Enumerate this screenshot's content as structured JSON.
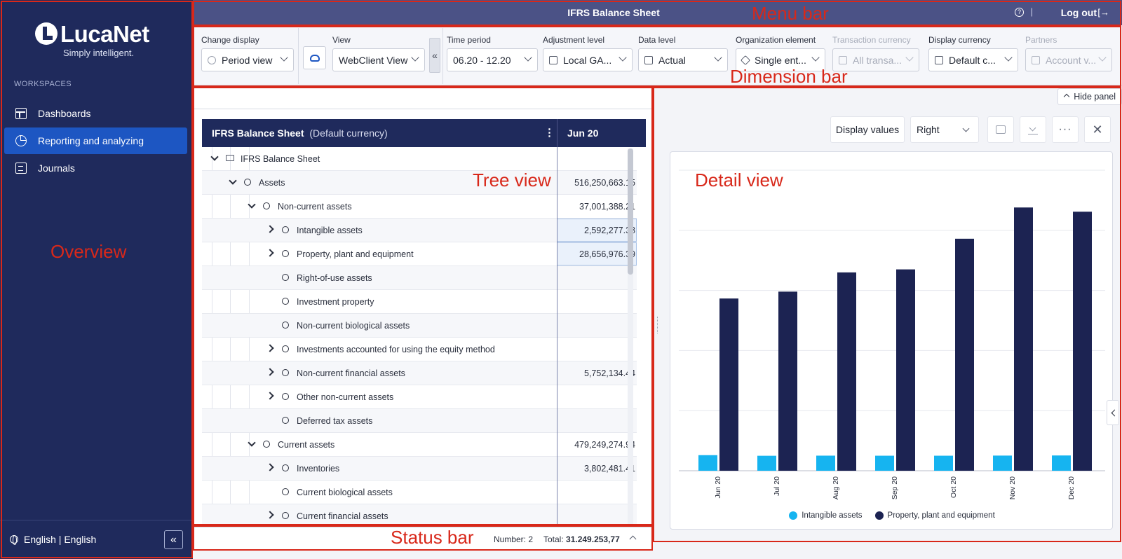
{
  "app": {
    "logo_name": "LucaNet",
    "logo_tagline": "Simply intelligent."
  },
  "sidebar": {
    "workspaces_label": "WORKSPACES",
    "items": [
      {
        "label": "Dashboards",
        "icon": "dashboard-icon",
        "active": false
      },
      {
        "label": "Reporting and analyzing",
        "icon": "pie-chart-icon",
        "active": true
      },
      {
        "label": "Journals",
        "icon": "journal-icon",
        "active": false
      }
    ],
    "language": "English | English",
    "collapse_label": "«"
  },
  "menubar": {
    "title": "IFRS Balance Sheet",
    "help_label": "?",
    "separator": "|",
    "logout_label": "Log out",
    "logout_icon": "[→"
  },
  "dimensions": {
    "change_display": {
      "label": "Change display",
      "value": "Period view"
    },
    "view": {
      "label": "View",
      "value": "WebClient View"
    },
    "collapse_label": "«",
    "time_period": {
      "label": "Time period",
      "value": "06.20 - 12.20"
    },
    "adjustment_level": {
      "label": "Adjustment level",
      "value": "Local GA..."
    },
    "data_level": {
      "label": "Data level",
      "value": "Actual"
    },
    "organization_element": {
      "label": "Organization element",
      "value": "Single ent..."
    },
    "transaction_currency": {
      "label": "Transaction currency",
      "value": "All transa..."
    },
    "display_currency": {
      "label": "Display currency",
      "value": "Default c..."
    },
    "partners": {
      "label": "Partners",
      "value": "Account v..."
    }
  },
  "tree": {
    "title": "IFRS Balance Sheet",
    "subtitle": "(Default currency)",
    "menu_icon": "⋮",
    "column": "Jun 20",
    "rows": [
      {
        "label": "IFRS Balance Sheet",
        "value": "",
        "level": 0,
        "expand": "down",
        "type": "folder",
        "selected": false
      },
      {
        "label": "Assets",
        "value": "516,250,663.15",
        "level": 1,
        "expand": "down",
        "type": "node",
        "selected": false
      },
      {
        "label": "Non-current assets",
        "value": "37,001,388.21",
        "level": 2,
        "expand": "down",
        "type": "node",
        "selected": false
      },
      {
        "label": "Intangible assets",
        "value": "2,592,277.38",
        "level": 3,
        "expand": "right",
        "type": "node",
        "selected": true
      },
      {
        "label": "Property, plant and equipment",
        "value": "28,656,976.39",
        "level": 3,
        "expand": "right",
        "type": "node",
        "selected": true
      },
      {
        "label": "Right-of-use assets",
        "value": "",
        "level": 3,
        "expand": "",
        "type": "node",
        "selected": false
      },
      {
        "label": "Investment property",
        "value": "",
        "level": 3,
        "expand": "",
        "type": "node",
        "selected": false
      },
      {
        "label": "Non-current biological assets",
        "value": "",
        "level": 3,
        "expand": "",
        "type": "node",
        "selected": false
      },
      {
        "label": "Investments accounted for using the equity method",
        "value": "",
        "level": 3,
        "expand": "right",
        "type": "node",
        "selected": false
      },
      {
        "label": "Non-current financial assets",
        "value": "5,752,134.44",
        "level": 3,
        "expand": "right",
        "type": "node",
        "selected": false
      },
      {
        "label": "Other non-current assets",
        "value": "",
        "level": 3,
        "expand": "right",
        "type": "node",
        "selected": false
      },
      {
        "label": "Deferred tax assets",
        "value": "",
        "level": 3,
        "expand": "",
        "type": "node",
        "selected": false
      },
      {
        "label": "Current assets",
        "value": "479,249,274.94",
        "level": 2,
        "expand": "down",
        "type": "node",
        "selected": false
      },
      {
        "label": "Inventories",
        "value": "3,802,481.41",
        "level": 3,
        "expand": "right",
        "type": "node",
        "selected": false
      },
      {
        "label": "Current biological assets",
        "value": "",
        "level": 3,
        "expand": "",
        "type": "node",
        "selected": false
      },
      {
        "label": "Current financial assets",
        "value": "",
        "level": 3,
        "expand": "right",
        "type": "node",
        "selected": false
      }
    ]
  },
  "status": {
    "number_label": "Number: 2",
    "total_label": "Total:",
    "total_value": "31.249.253,77"
  },
  "detail": {
    "hide_panel_label": "Hide panel",
    "display_values_label": "Display values",
    "position_value": "Right",
    "more_label": "···",
    "close_label": "✕"
  },
  "chart_data": {
    "type": "bar",
    "categories": [
      "Jun 20",
      "Jul 20",
      "Aug 20",
      "Sep 20",
      "Oct 20",
      "Nov 20",
      "Dec 20"
    ],
    "series": [
      {
        "name": "Intangible assets",
        "color": "#16b4f0",
        "values": [
          2592277.38,
          2490000,
          2510000,
          2500000,
          2500000,
          2520000,
          2540000
        ]
      },
      {
        "name": "Property, plant and equipment",
        "color": "#1c2352",
        "values": [
          28656976.39,
          29800000,
          33000000,
          33500000,
          38600000,
          43800000,
          43100000
        ]
      }
    ],
    "ylim": [
      0,
      50000000
    ],
    "grid": true,
    "legend_position": "bottom"
  },
  "annotations": {
    "menu_bar": "Menu bar",
    "dimension_bar": "Dimension bar",
    "overview": "Overview",
    "tree_view": "Tree view",
    "detail_view": "Detail view",
    "status_bar": "Status bar",
    "color": "#d8281a"
  }
}
